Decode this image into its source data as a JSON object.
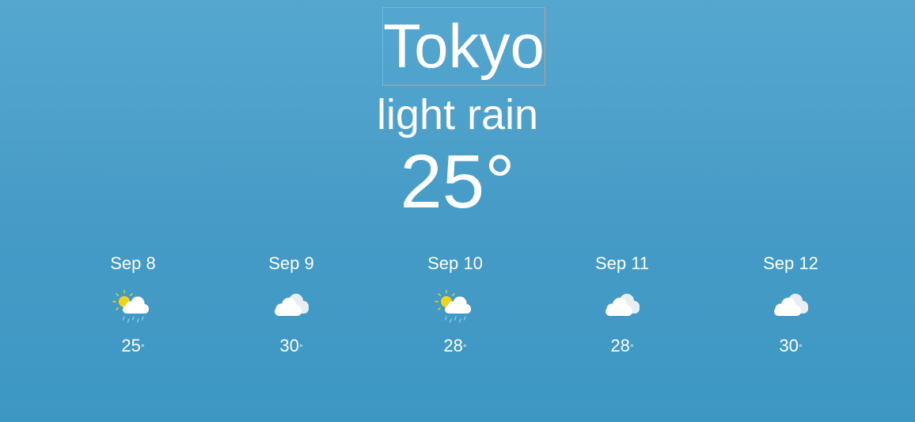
{
  "current": {
    "city": "Tokyo",
    "condition": "light rain",
    "temperature": "25°"
  },
  "forecast": [
    {
      "date": "Sep 8",
      "icon": "sun-cloud-rain-icon",
      "temp": "25",
      "degree": "°"
    },
    {
      "date": "Sep 9",
      "icon": "cloud-icon",
      "temp": "30",
      "degree": "°"
    },
    {
      "date": "Sep 10",
      "icon": "sun-cloud-rain-icon",
      "temp": "28",
      "degree": "°"
    },
    {
      "date": "Sep 11",
      "icon": "cloud-icon",
      "temp": "28",
      "degree": "°"
    },
    {
      "date": "Sep 12",
      "icon": "cloud-icon",
      "temp": "30",
      "degree": "°"
    }
  ],
  "colors": {
    "background_top": "#55a7cf",
    "background_bottom": "#3d97c3",
    "sun": "#f2d31b",
    "cloud": "#ffffff",
    "rain": "#8fcdf0"
  }
}
